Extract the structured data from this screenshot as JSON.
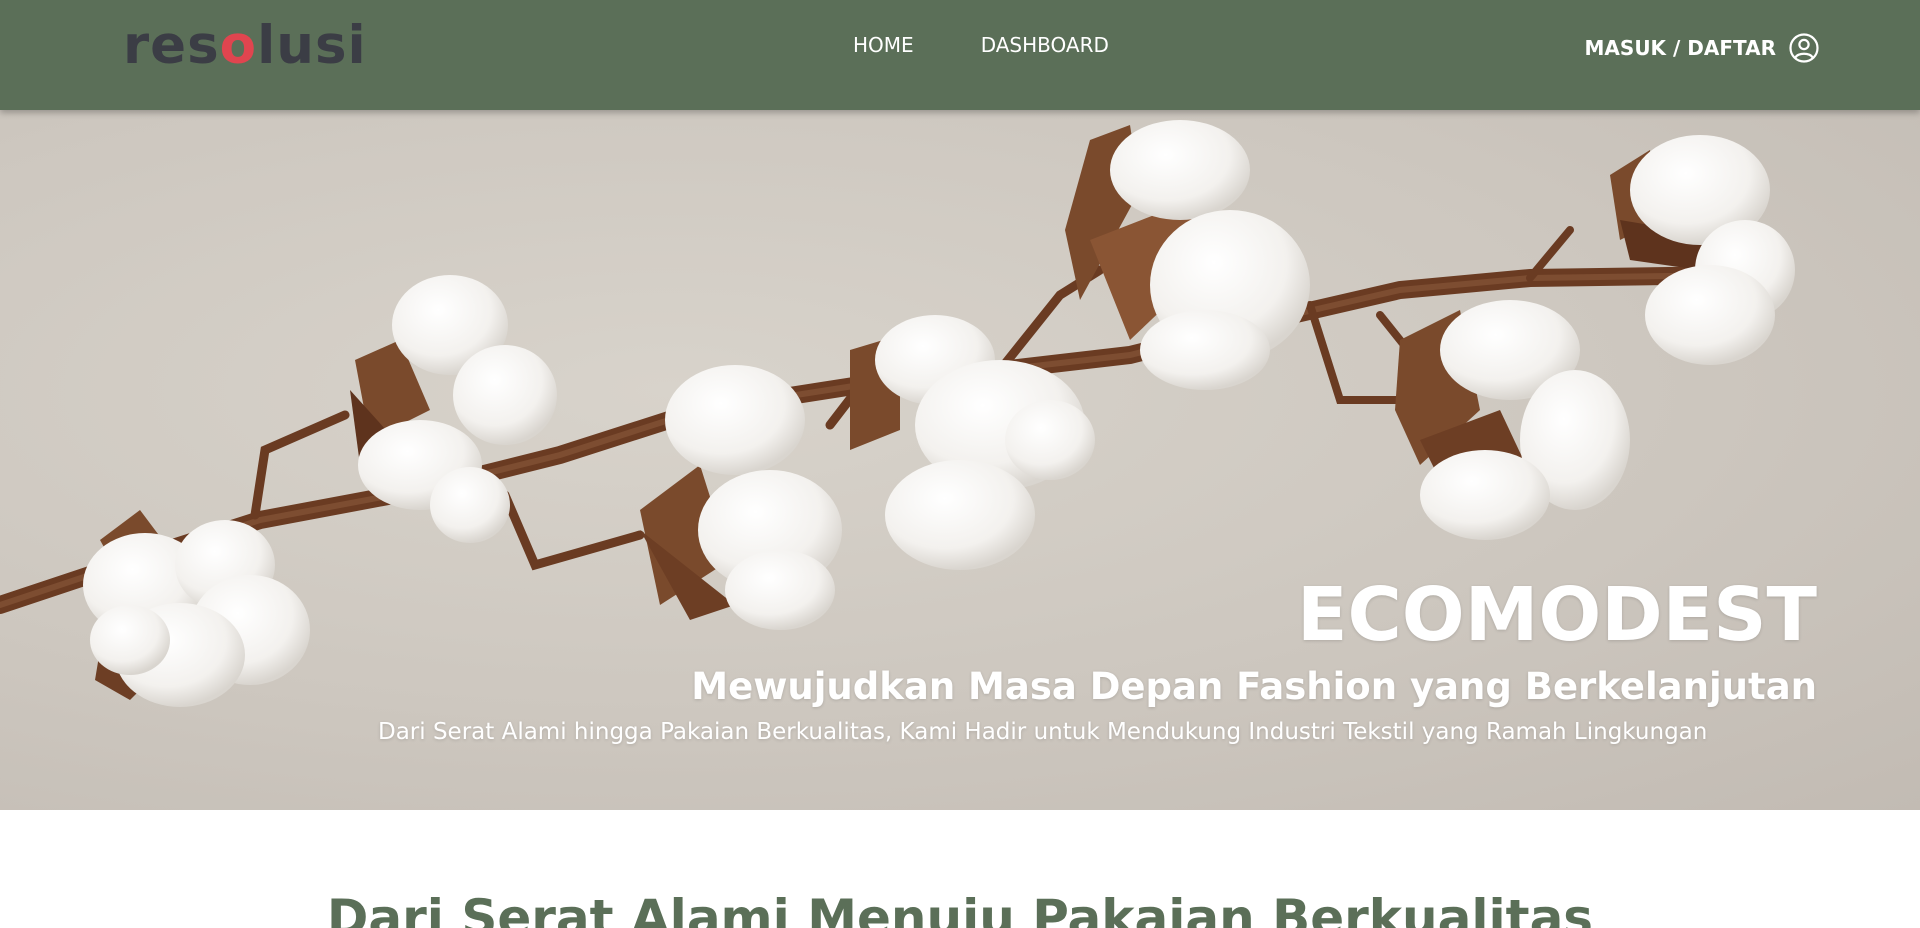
{
  "navbar": {
    "logo_prefix": "res",
    "logo_accent": "o",
    "logo_suffix": "lusi",
    "links": [
      {
        "label": "HOME"
      },
      {
        "label": "DASHBOARD"
      }
    ],
    "auth_label": "MASUK / DAFTAR",
    "auth_icon": "user-circle-icon",
    "background_color": "#5b6f58",
    "logo_color": "#3b3d45",
    "logo_accent_color": "#e0454f"
  },
  "hero": {
    "title": "ECOMODEST",
    "subtitle": "Mewujudkan Masa Depan Fashion yang Berkelanjutan",
    "tagline": "Dari Serat Alami hingga Pakaian Berkualitas, Kami Hadir untuk Mendukung Industri Tekstil yang Ramah Lingkungan",
    "image_subject": "cotton branch"
  },
  "section": {
    "heading": "Dari Serat Alami Menuju Pakaian Berkualitas",
    "heading_color": "#5b6f58"
  }
}
